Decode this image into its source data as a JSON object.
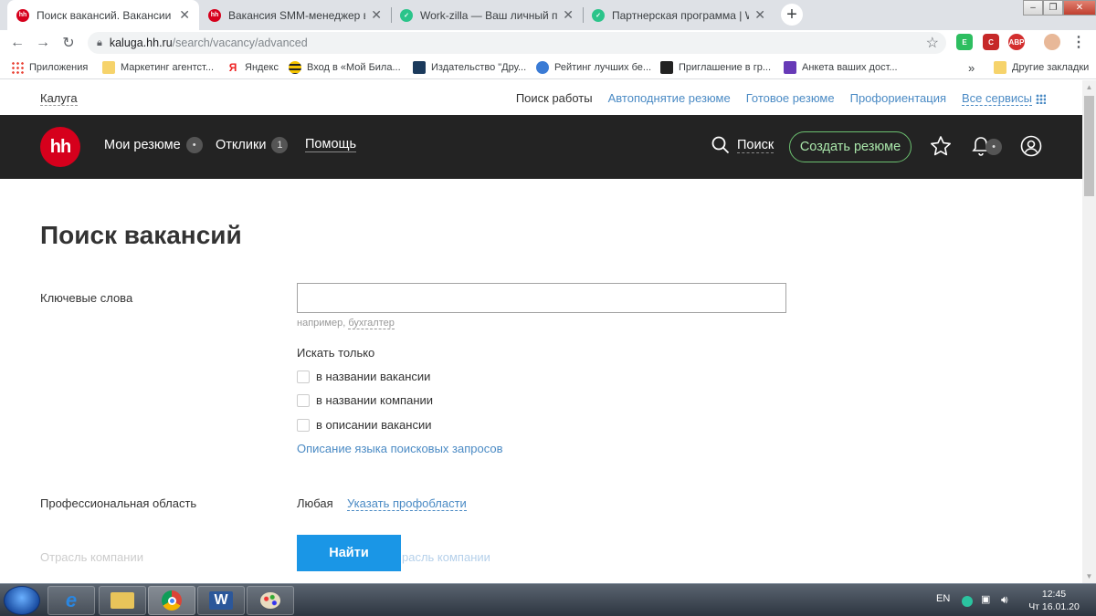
{
  "browser": {
    "tabs": [
      {
        "title": "Поиск вакансий. Вакансии круп",
        "favicon": "hh-logo-icon",
        "active": true
      },
      {
        "title": "Вакансия SMM-менеджер в Мо",
        "favicon": "hh-logo-icon",
        "active": false
      },
      {
        "title": "Work-zilla — Ваш личный помо",
        "favicon": "workzilla-check-icon",
        "active": false
      },
      {
        "title": "Партнерская программа | Work",
        "favicon": "workzilla-check-icon",
        "active": false
      }
    ],
    "url_host": "kaluga.hh.ru",
    "url_path": "/search/vacancy/advanced",
    "bookmarks": [
      {
        "label": "Приложения",
        "icon": "apps-grid-icon"
      },
      {
        "label": "Маркетинг агентст...",
        "icon": "folder-icon"
      },
      {
        "label": "Яндекс",
        "icon": "yandex-icon"
      },
      {
        "label": "Вход в «Мой Била...",
        "icon": "beeline-icon"
      },
      {
        "label": "Издательство \"Дру...",
        "icon": "publisher-icon"
      },
      {
        "label": "Рейтинг лучших бе...",
        "icon": "globe-icon"
      },
      {
        "label": "Приглашение в гр...",
        "icon": "invite-icon"
      },
      {
        "label": "Анкета ваших дост...",
        "icon": "form-icon"
      }
    ],
    "bookmarks_more": "»",
    "other_bookmarks": "Другие закладки"
  },
  "site": {
    "city": "Калуга",
    "subnav": [
      "Поиск работы",
      "Автоподнятие резюме",
      "Готовое резюме",
      "Профориентация",
      "Все сервисы"
    ],
    "logo_text": "hh",
    "nav": {
      "resumes": "Мои резюме",
      "resumes_badge": "•",
      "responses": "Отклики",
      "responses_badge": "1",
      "help": "Помощь"
    },
    "search_label": "Поиск",
    "create_resume": "Создать резюме",
    "notifications_badge": "•"
  },
  "form": {
    "title": "Поиск вакансий",
    "keywords_label": "Ключевые слова",
    "keywords_value": "",
    "hint_prefix": "например, ",
    "hint_example": "бухгалтер",
    "search_only": "Искать только",
    "checkboxes": [
      "в названии вакансии",
      "в названии компании",
      "в описании вакансии"
    ],
    "query_lang_link": "Описание языка поисковых запросов",
    "prof_area_label": "Профессиональная область",
    "prof_area_value": "Любая",
    "prof_area_link": "Указать профобласти",
    "industry_label": "Отрасль компании",
    "industry_link": "расль компании",
    "submit": "Найти"
  },
  "taskbar": {
    "lang": "EN",
    "time": "12:45",
    "date": "Чт 16.01.20"
  }
}
